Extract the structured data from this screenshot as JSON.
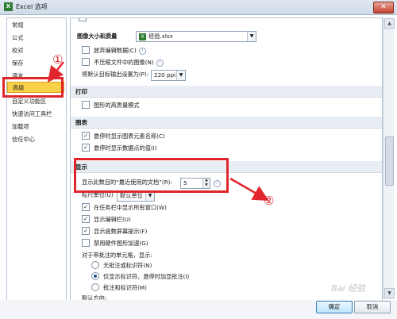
{
  "window": {
    "title": "Excel 选项",
    "close_glyph": "✕"
  },
  "sidebar": {
    "items": [
      {
        "label": "常规"
      },
      {
        "label": "公式"
      },
      {
        "label": "校对"
      },
      {
        "label": "保存"
      },
      {
        "label": "语言"
      },
      {
        "label": "高级",
        "selected": true
      },
      {
        "label": "自定义功能区"
      },
      {
        "label": "快速访问工具栏"
      },
      {
        "label": "加载项"
      },
      {
        "label": "信任中心"
      }
    ]
  },
  "image_quality": {
    "label": "图像大小和质量",
    "file_value": "经验.xlsx",
    "discard_edit_data": "放弃编辑数据(C)",
    "no_compress": "不压缩文件中的图像(N)",
    "default_output_label": "将默认目标输出设置为(P):",
    "default_output_value": "220 ppi"
  },
  "print": {
    "header": "打印",
    "high_quality": "图形的高质量模式"
  },
  "chart": {
    "header": "图表",
    "show_element_names": "悬停时显示图表元素名称(C)",
    "show_data_values": "悬停时显示数据点的值(I)"
  },
  "display": {
    "header": "显示",
    "recent_docs_label": "显示此数目的“最近使用的文档”(R):",
    "recent_docs_value": "5",
    "ruler_units_label": "标尺单位(U)",
    "ruler_units_value": "默认单位",
    "show_all_windows": "在任务栏中显示所有窗口(W)",
    "show_formula_bar": "显示编辑栏(U)",
    "show_function_tips": "显示函数屏幕提示(F)",
    "disable_hw_accel": "禁用硬件图形加速(G)",
    "comment_label": "对于带批注的单元格，显示:",
    "comment_opt1": "无批注或标识符(N)",
    "comment_opt2": "仅显示标识符，悬停时加显批注(I)",
    "comment_opt3": "批注和标识符(M)",
    "default_direction": "默认方向:"
  },
  "buttons": {
    "ok": "确定",
    "cancel": "取消"
  },
  "annotations": {
    "num1": "①",
    "num2": "②",
    "accent": "#e0262c"
  },
  "watermark": "Bai 经验"
}
